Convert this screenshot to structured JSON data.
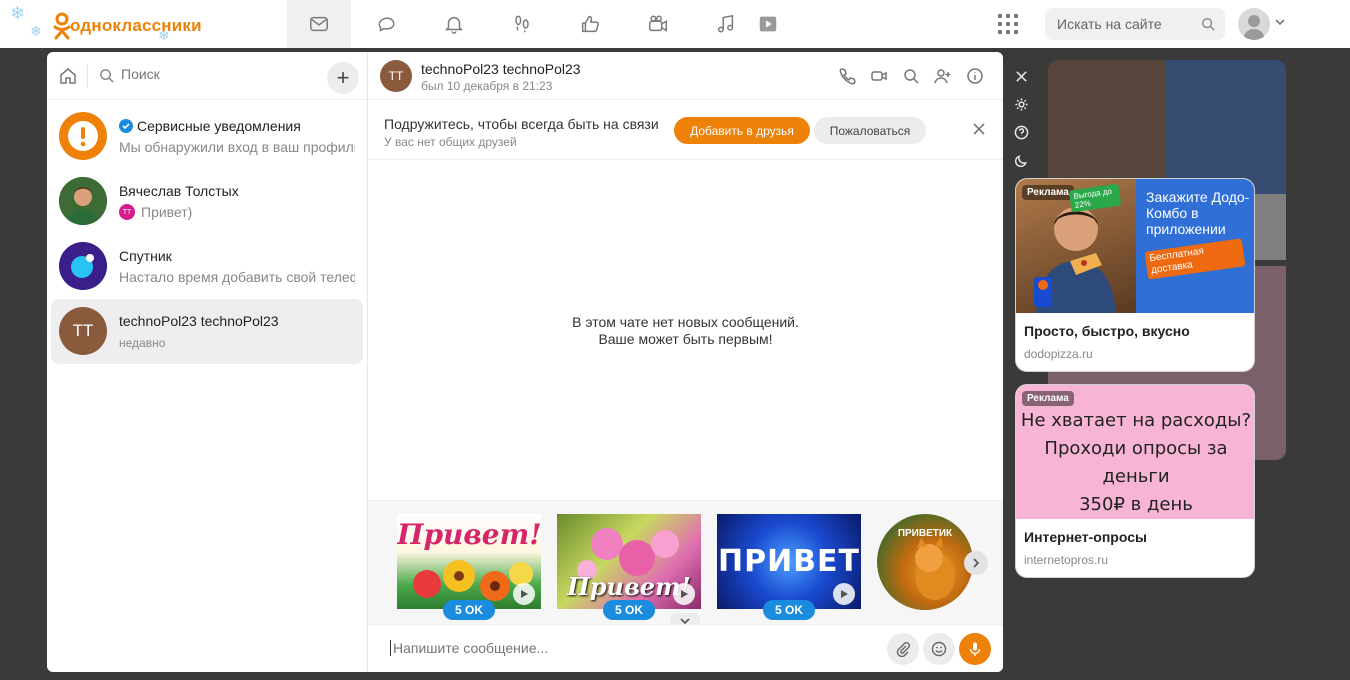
{
  "site": {
    "logo_text": "одноклассники"
  },
  "nav": [
    "messages",
    "discussions",
    "notifications",
    "guests",
    "events",
    "friends",
    "music",
    "video"
  ],
  "search": {
    "placeholder": "Искать на сайте"
  },
  "messenger": {
    "search_placeholder": "Поиск",
    "chats": [
      {
        "name": "Сервисные уведомления",
        "preview": "Мы обнаружили вход в ваш профиль",
        "verified": true
      },
      {
        "name": "Вячеслав Толстых",
        "preview": "Привет)"
      },
      {
        "name": "Спутник",
        "preview": "Настало время добавить свой телефон"
      },
      {
        "name": "technoPol23 technoPol23",
        "preview": "недавно",
        "initials": "TT"
      }
    ],
    "conversation": {
      "name": "technoPol23 technoPol23",
      "initials": "TT",
      "status": "был 10 декабря в 21:23",
      "friend_prompt": "Подружитесь, чтобы всегда быть на связи",
      "friend_sub": "У вас нет общих друзей",
      "add_friend_label": "Добавить в друзья",
      "report_label": "Пожаловаться",
      "empty_line1": "В этом чате нет новых сообщений.",
      "empty_line2": "Ваше может быть первым!",
      "stickers": [
        {
          "text": "Привет!",
          "price": "5 OK"
        },
        {
          "text": "Привет!",
          "price": "5 OK"
        },
        {
          "text": "ПРИВЕТ",
          "price": "5 OK"
        },
        {
          "text": "ПРИВЕТИК"
        }
      ],
      "composer_placeholder": "Напишите сообщение..."
    }
  },
  "ads": [
    {
      "tag": "Реклама",
      "headline": "Закажите Додо-Комбо в приложении",
      "badge": "Выгода до 22%",
      "cta": "Бесплатная доставка",
      "title": "Просто, быстро, вкусно",
      "domain": "dodopizza.ru"
    },
    {
      "tag": "Реклама",
      "line1": "Не хватает на расходы?",
      "line2": "Проходи опросы за деньги",
      "line3": "350₽ в день",
      "title": "Интернет-опросы",
      "domain": "internetopros.ru"
    }
  ],
  "colors": {
    "accent": "#ee8208",
    "blue": "#1a8ce0",
    "overlay": "#3a3a3a"
  }
}
